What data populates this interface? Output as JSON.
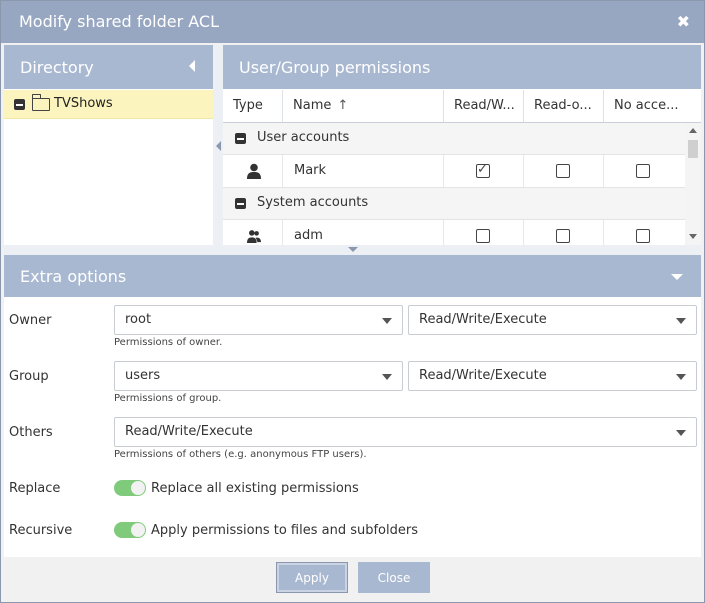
{
  "dialog": {
    "title": "Modify shared folder ACL",
    "close_glyph": "✖"
  },
  "directory": {
    "title": "Directory",
    "items": [
      {
        "label": "TVShows",
        "icon": "folder-open-icon"
      }
    ]
  },
  "permissions": {
    "title": "User/Group permissions",
    "columns": [
      "Type",
      "Name",
      "Read/W...",
      "Read-o...",
      "No acce..."
    ],
    "sort_glyph": "↑",
    "groups": [
      {
        "label": "User accounts",
        "rows": [
          {
            "name": "Mark",
            "type": "user-icon",
            "read_write": true,
            "read_only": false,
            "no_access": false
          }
        ]
      },
      {
        "label": "System accounts",
        "rows": [
          {
            "name": "adm",
            "type": "group-icon",
            "read_write": false,
            "read_only": false,
            "no_access": false
          }
        ]
      }
    ]
  },
  "extra": {
    "title": "Extra options",
    "owner": {
      "label": "Owner",
      "user": "root",
      "perm": "Read/Write/Execute",
      "hint": "Permissions of owner."
    },
    "group": {
      "label": "Group",
      "user": "users",
      "perm": "Read/Write/Execute",
      "hint": "Permissions of group."
    },
    "others": {
      "label": "Others",
      "perm": "Read/Write/Execute",
      "hint": "Permissions of others (e.g. anonymous FTP users)."
    },
    "replace": {
      "label": "Replace",
      "text": "Replace all existing permissions",
      "on": true
    },
    "recursive": {
      "label": "Recursive",
      "text": "Apply permissions to files and subfolders",
      "on": true
    }
  },
  "footer": {
    "apply_label": "Apply",
    "close_label": "Close"
  },
  "colors": {
    "header": "#a9b8d1",
    "titlebar": "#97a6c1",
    "selected_row": "#fbf4bf",
    "toggle_on": "#7fca7b"
  }
}
